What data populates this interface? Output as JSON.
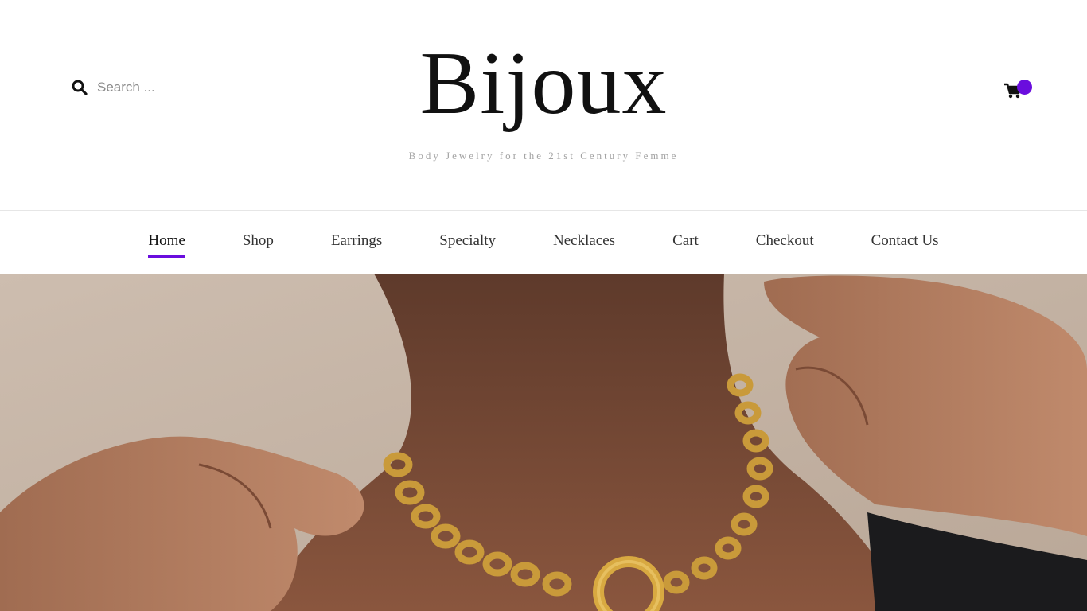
{
  "header": {
    "site_title": "Bijoux",
    "tagline": "Body Jewelry for the 21st Century Femme",
    "search": {
      "placeholder": "Search ...",
      "value": "",
      "icon": "search-icon"
    },
    "cart": {
      "icon": "cart-icon",
      "badge_color": "#6a0dde"
    }
  },
  "nav": {
    "items": [
      {
        "label": "Home",
        "active": true
      },
      {
        "label": "Shop"
      },
      {
        "label": "Earrings"
      },
      {
        "label": "Specialty"
      },
      {
        "label": "Necklaces"
      },
      {
        "label": "Cart"
      },
      {
        "label": "Checkout"
      },
      {
        "label": "Contact Us"
      }
    ],
    "accent_color": "#6a0dde"
  },
  "hero": {
    "image": "model wearing gold chain necklace",
    "colors": {
      "background": "#c9b9aa",
      "skin": "#7a4a35",
      "gold": "#c99a3a"
    }
  }
}
